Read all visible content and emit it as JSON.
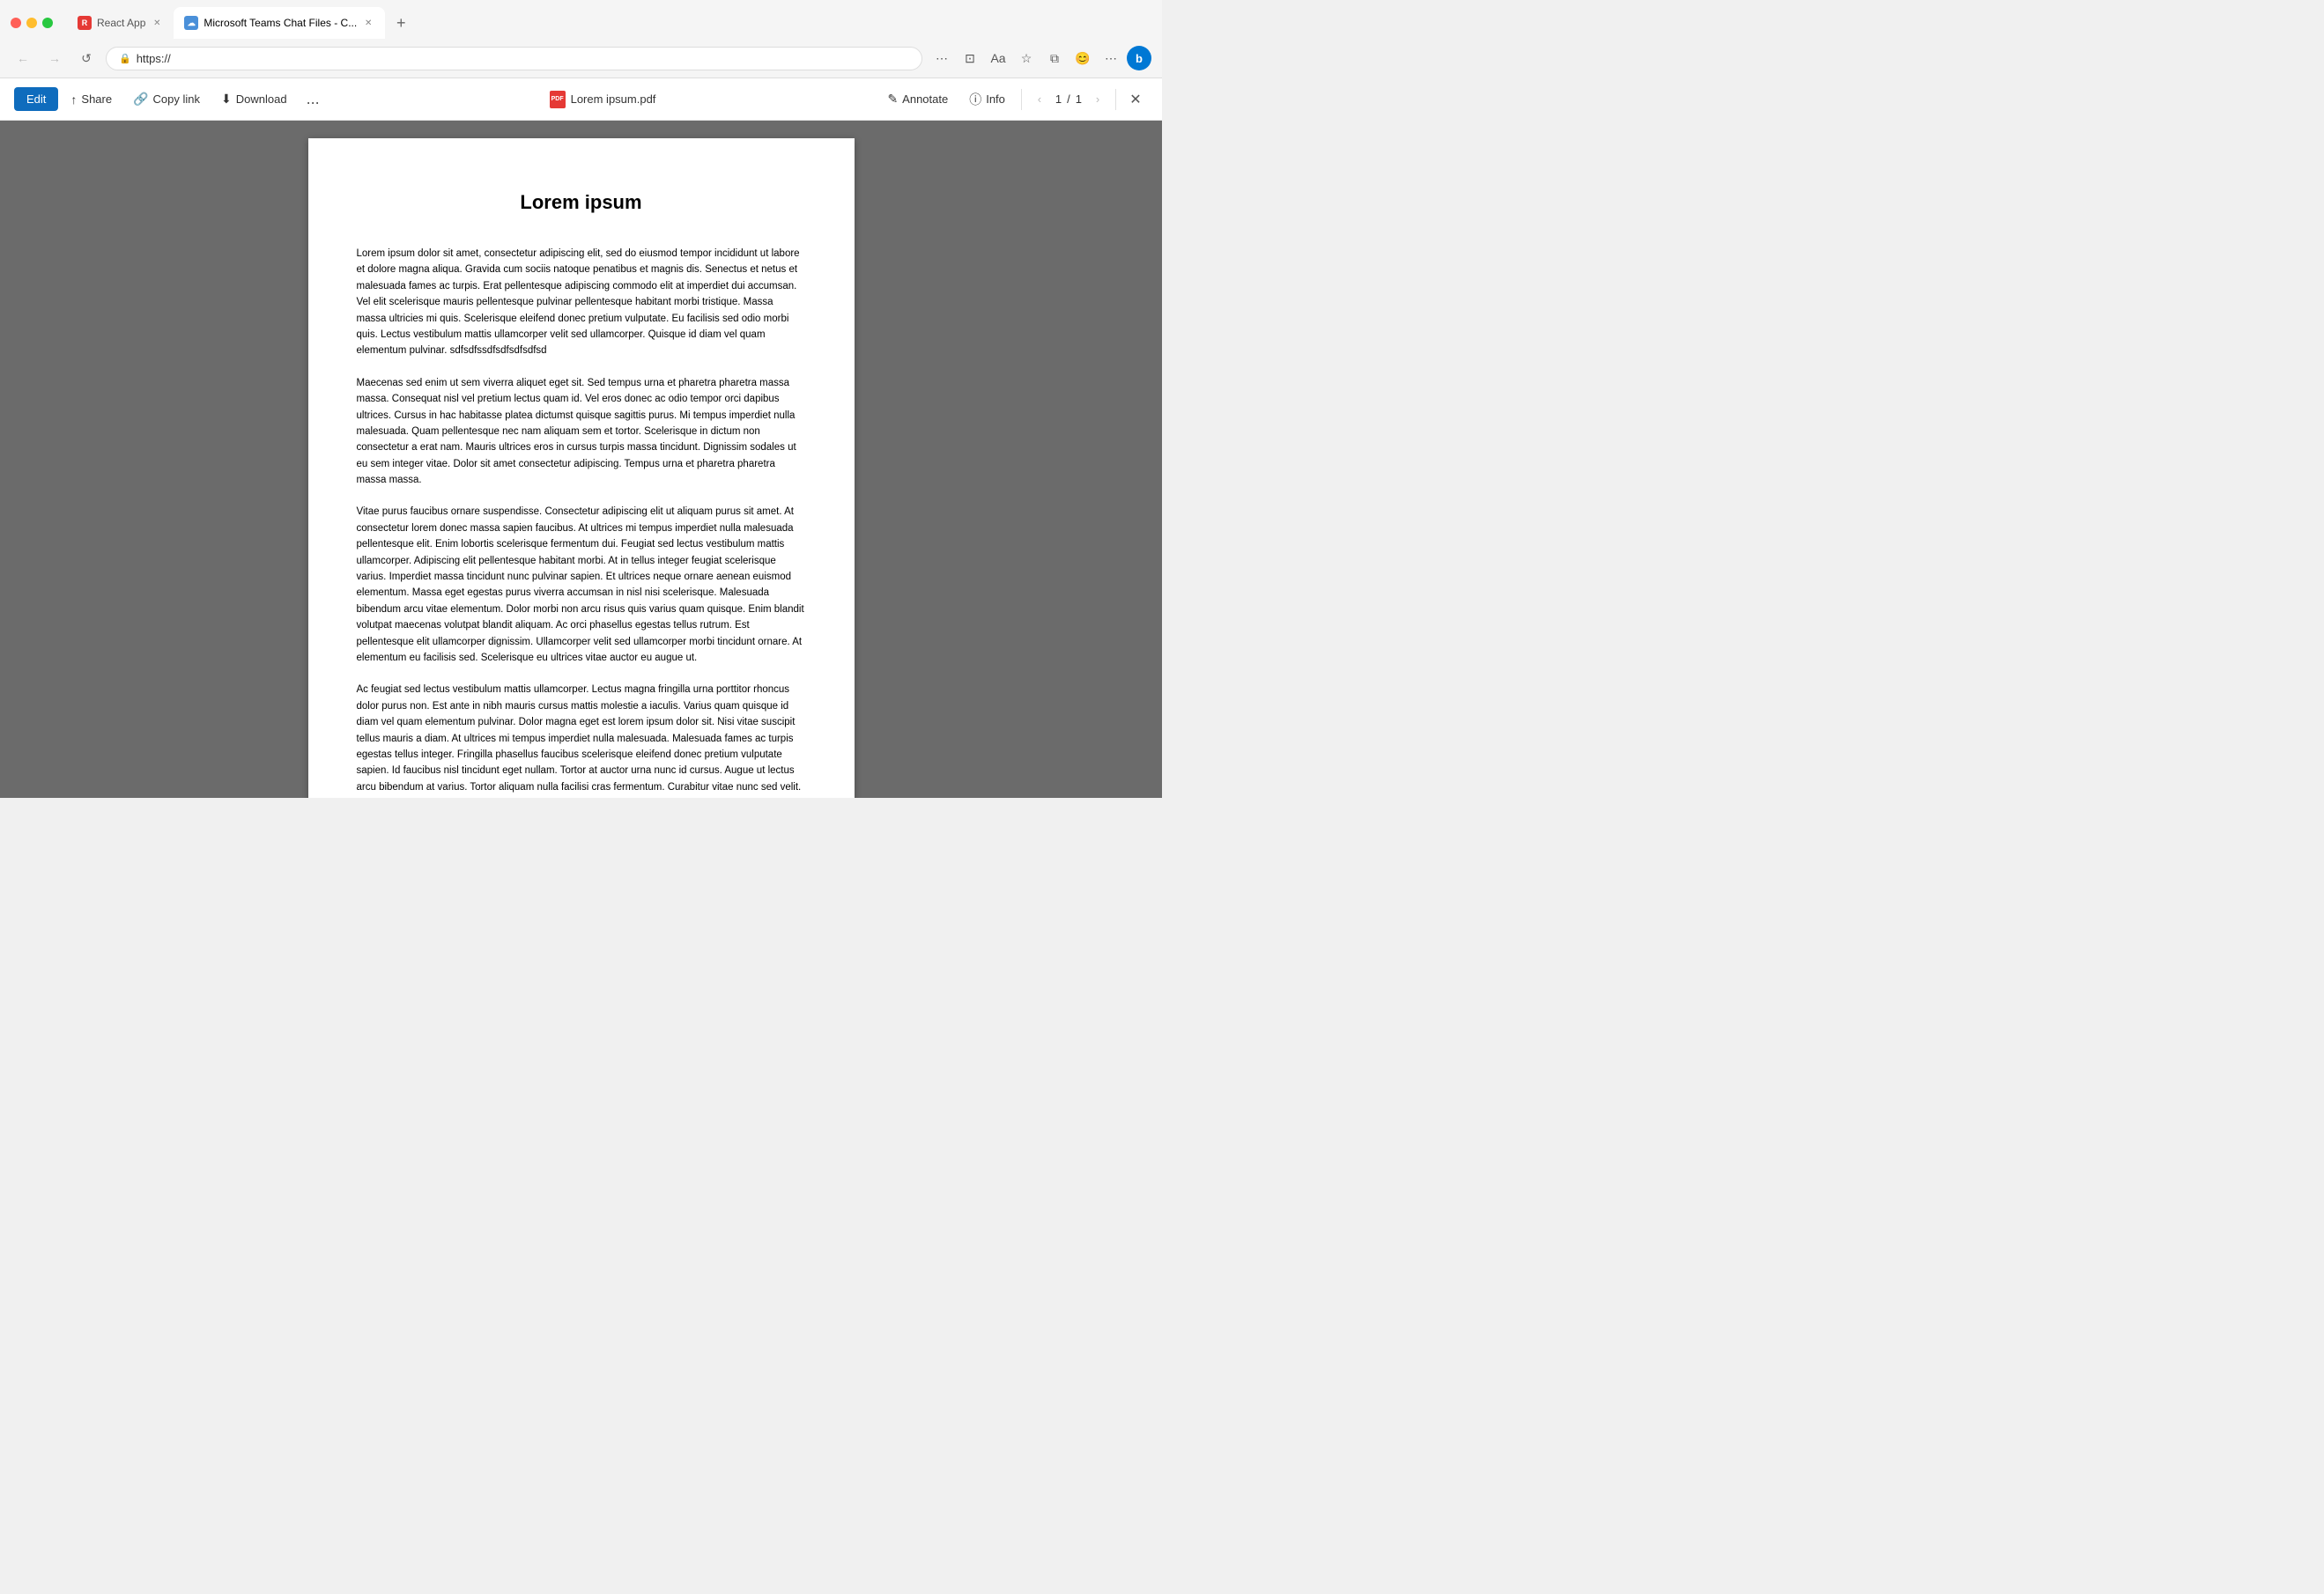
{
  "browser": {
    "tabs": [
      {
        "id": "react-app",
        "label": "React App",
        "icon_color": "#e53935",
        "active": false
      },
      {
        "id": "teams-chat",
        "label": "Microsoft Teams Chat Files - C...",
        "icon_color": "#4a90d9",
        "active": true
      }
    ],
    "url": "https://",
    "new_tab_label": "+"
  },
  "pdf_toolbar": {
    "edit_label": "Edit",
    "share_label": "Share",
    "copy_link_label": "Copy link",
    "download_label": "Download",
    "more_label": "...",
    "filename": "Lorem ipsum.pdf",
    "annotate_label": "Annotate",
    "info_label": "Info",
    "page_current": "1",
    "page_total": "1",
    "page_separator": "/"
  },
  "pdf_content": {
    "title": "Lorem ipsum",
    "paragraph1": "Lorem ipsum dolor sit amet, consectetur adipiscing elit, sed do eiusmod tempor incididunt ut labore et dolore magna aliqua. Gravida cum sociis natoque penatibus et magnis dis. Senectus et netus et malesuada fames ac turpis. Erat pellentesque adipiscing commodo elit at imperdiet dui accumsan. Vel elit scelerisque mauris pellentesque pulvinar pellentesque habitant morbi tristique. Massa massa ultricies mi quis. Scelerisque eleifend donec pretium vulputate. Eu facilisis sed odio morbi quis. Lectus vestibulum mattis ullamcorper velit sed ullamcorper. Quisque id diam vel quam elementum pulvinar. sdfsdfssdfsdfsdfsdfsd",
    "paragraph2": "Maecenas sed enim ut sem viverra aliquet eget sit. Sed tempus urna et pharetra pharetra massa massa. Consequat nisl vel pretium lectus quam id. Vel eros donec ac odio tempor orci dapibus ultrices. Cursus in hac habitasse platea dictumst quisque sagittis purus. Mi tempus imperdiet nulla malesuada. Quam pellentesque nec nam aliquam sem et tortor. Scelerisque in dictum non consectetur a erat nam. Mauris ultrices eros in cursus turpis massa tincidunt. Dignissim sodales ut eu sem integer vitae. Dolor sit amet consectetur adipiscing. Tempus urna et pharetra pharetra massa massa.",
    "paragraph3": "Vitae purus faucibus ornare suspendisse. Consectetur adipiscing elit ut aliquam purus sit amet. At consectetur lorem donec massa sapien faucibus. At ultrices mi tempus imperdiet nulla malesuada pellentesque elit. Enim lobortis scelerisque fermentum dui. Feugiat sed lectus vestibulum mattis ullamcorper. Adipiscing elit pellentesque habitant morbi. At in tellus integer feugiat scelerisque varius. Imperdiet massa tincidunt nunc pulvinar sapien. Et ultrices neque ornare aenean euismod elementum. Massa eget egestas purus viverra accumsan in nisl nisi scelerisque. Malesuada bibendum arcu vitae elementum. Dolor morbi non arcu risus quis varius quam quisque. Enim blandit volutpat maecenas volutpat blandit aliquam. Ac orci phasellus egestas tellus rutrum. Est pellentesque elit ullamcorper dignissim. Ullamcorper velit sed ullamcorper morbi tincidunt ornare. At elementum eu facilisis sed. Scelerisque eu ultrices vitae auctor eu augue ut.",
    "paragraph4": "Ac feugiat sed lectus vestibulum mattis ullamcorper. Lectus magna fringilla urna porttitor rhoncus dolor purus non. Est ante in nibh mauris cursus mattis molestie a iaculis. Varius quam quisque id diam vel quam elementum pulvinar. Dolor magna eget est lorem ipsum dolor sit. Nisi vitae suscipit tellus mauris a diam. At ultrices mi tempus imperdiet nulla malesuada. Malesuada fames ac turpis egestas tellus integer. Fringilla phasellus faucibus scelerisque eleifend donec pretium vulputate sapien. Id faucibus nisl tincidunt eget nullam. Tortor at auctor urna nunc id cursus. Augue ut lectus arcu bibendum at varius. Tortor aliquam nulla facilisi cras fermentum. Curabitur vitae nunc sed velit. Semper eget duis at tellus. Facilisi cras fermentum odio eu feugiat pretium."
  }
}
